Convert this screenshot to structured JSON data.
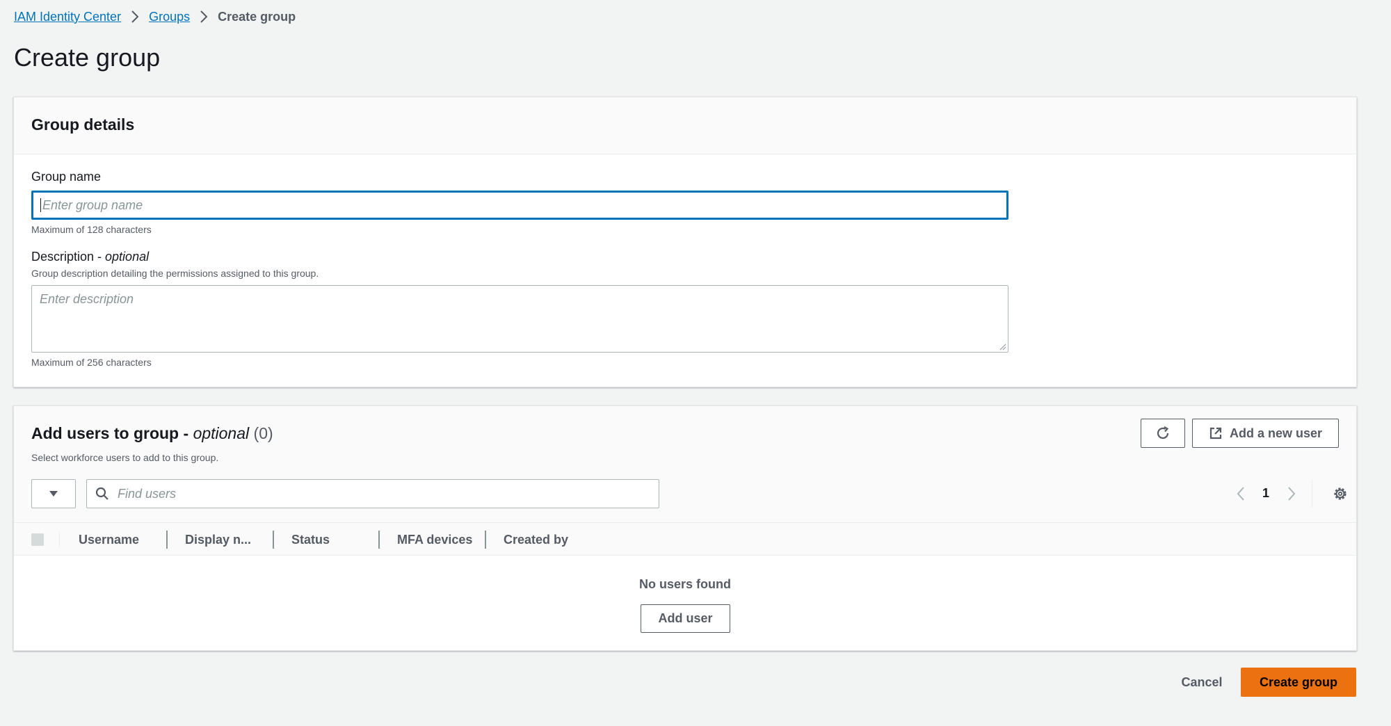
{
  "breadcrumb": {
    "items": [
      "IAM Identity Center",
      "Groups"
    ],
    "current": "Create group"
  },
  "page_title": "Create group",
  "group_details": {
    "title": "Group details",
    "name_label": "Group name",
    "name_placeholder": "Enter group name",
    "name_hint": "Maximum of 128 characters",
    "desc_label": "Description - ",
    "desc_label_optional": "optional",
    "desc_help": "Group description detailing the permissions assigned to this group.",
    "desc_placeholder": "Enter description",
    "desc_hint": "Maximum of 256 characters"
  },
  "users": {
    "title": "Add users to group - ",
    "title_optional": "optional",
    "count": "(0)",
    "subtitle": "Select workforce users to add to this group.",
    "add_new_user_label": "Add a new user",
    "search_placeholder": "Find users",
    "page_number": "1",
    "columns": [
      "Username",
      "Display n...",
      "Status",
      "MFA devices",
      "Created by"
    ],
    "empty_text": "No users found",
    "add_user_label": "Add user"
  },
  "footer": {
    "cancel_label": "Cancel",
    "create_label": "Create group"
  },
  "colors": {
    "link": "#0073bb",
    "primary": "#ec7211",
    "background": "#f2f3f3"
  },
  "icons": [
    "chevron-right-icon",
    "refresh-icon",
    "external-link-icon",
    "caret-down-icon",
    "search-icon",
    "chevron-left-icon",
    "gear-icon"
  ]
}
